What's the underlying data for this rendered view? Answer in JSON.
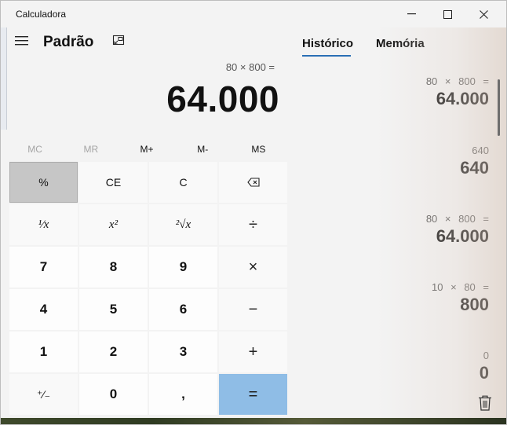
{
  "window": {
    "title": "Calculadora",
    "controls": {
      "minimize": "–",
      "maximize": "☐",
      "close": "✕"
    }
  },
  "header": {
    "mode": "Padrão",
    "menu_icon": "hamburger-icon",
    "keep_on_top_icon": "keep-on-top-icon"
  },
  "display": {
    "expression": "80 × 800 =",
    "result": "64.000"
  },
  "memory": {
    "mc": "MC",
    "mr": "MR",
    "mplus": "M+",
    "mminus": "M-",
    "ms": "MS"
  },
  "keypad": {
    "percent": "%",
    "ce": "CE",
    "c": "C",
    "backspace_icon": "backspace-icon",
    "reciprocal": "¹⁄x",
    "square": "x²",
    "sqrt": "²√x",
    "divide": "÷",
    "seven": "7",
    "eight": "8",
    "nine": "9",
    "multiply": "×",
    "four": "4",
    "five": "5",
    "six": "6",
    "minus": "−",
    "one": "1",
    "two": "2",
    "three": "3",
    "plus": "+",
    "negate": "⁺⁄₋",
    "zero": "0",
    "decimal": ",",
    "equals": "="
  },
  "tabs": {
    "history": "Histórico",
    "memory": "Memória"
  },
  "history": [
    {
      "expression": "80 × 800 =",
      "value": "64.000"
    },
    {
      "expression": "640",
      "value": "640"
    },
    {
      "expression": "80 × 800 =",
      "value": "64.000"
    },
    {
      "expression": "10 × 80 =",
      "value": "800"
    },
    {
      "expression": "0",
      "value": "0"
    }
  ],
  "accent_color": "#8fbde6"
}
